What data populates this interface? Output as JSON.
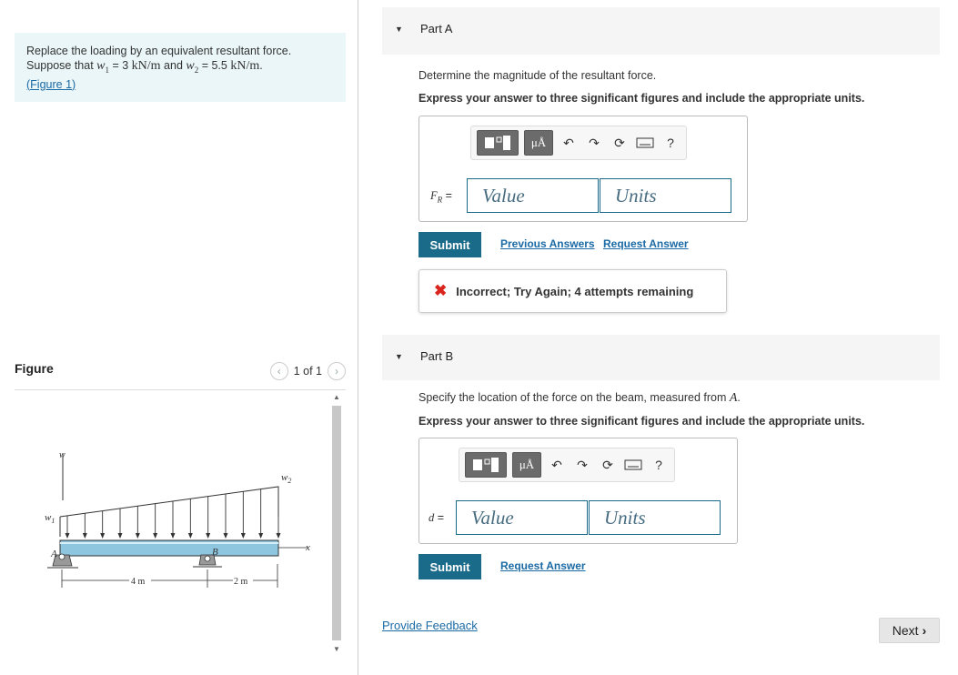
{
  "problem": {
    "line1": "Replace the loading by an equivalent resultant force.",
    "suppose": "Suppose that",
    "w1_sym": "w",
    "w1_sub": "1",
    "w1_val": " = 3 ",
    "w1_unit": "kN/m",
    "and": " and ",
    "w2_sym": "w",
    "w2_sub": "2",
    "w2_val": " = 5.5 ",
    "w2_unit": "kN/m",
    "dot": ".",
    "fig_link_open": "(",
    "fig_link": "Figure 1",
    "fig_link_close": ")"
  },
  "figure": {
    "title": "Figure",
    "pager": "1 of 1",
    "labels": {
      "w": "w",
      "w1": "w",
      "w1_sub": "1",
      "w2": "w",
      "w2_sub": "2",
      "A": "A",
      "B": "B",
      "x": "x",
      "dim1": "4 m",
      "dim2": "2 m"
    }
  },
  "partA": {
    "label": "Part A",
    "question": "Determine the magnitude of the resultant force.",
    "instruction": "Express your answer to three significant figures and include the appropriate units.",
    "mu": "μÅ",
    "help": "?",
    "field_label_main": "F",
    "field_label_sub": "R",
    "field_label_eq": " =",
    "value_placeholder": "Value",
    "units_placeholder": "Units",
    "submit": "Submit",
    "prev_answers": "Previous Answers",
    "request_answer": "Request Answer",
    "feedback": "Incorrect; Try Again; 4 attempts remaining"
  },
  "partB": {
    "label": "Part B",
    "question_pre": "Specify the location of the force on the beam, measured from ",
    "question_sym": "A",
    "question_post": ".",
    "instruction": "Express your answer to three significant figures and include the appropriate units.",
    "mu": "μÅ",
    "help": "?",
    "field_label": "d",
    "field_label_eq": " =",
    "value_placeholder": "Value",
    "units_placeholder": "Units",
    "submit": "Submit",
    "request_answer": "Request Answer"
  },
  "footer": {
    "feedback_link": "Provide Feedback",
    "next": "Next"
  },
  "colors": {
    "accent": "#1a6a8a",
    "problem_bg": "#eaf6f8",
    "error": "#d9251d",
    "beam": "#8fc6df"
  }
}
